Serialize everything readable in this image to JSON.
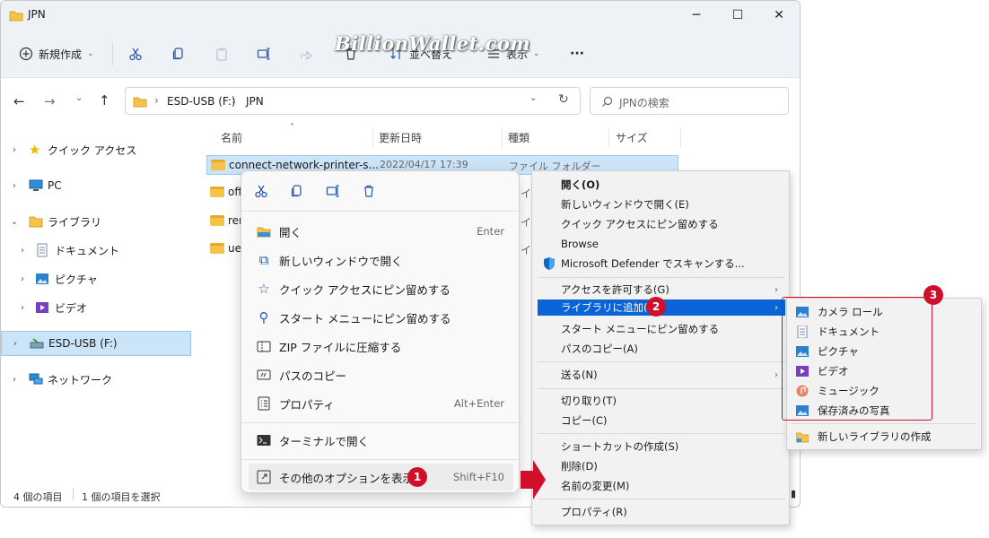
{
  "window": {
    "title": "JPN",
    "minimize_icon": "─",
    "maximize_icon": "☐",
    "close_icon": "✕"
  },
  "watermark": "BillionWallet.com",
  "toolbar": {
    "new_label": "新規作成",
    "sort_label": "並べ替え",
    "view_label": "表示",
    "more_label": "···"
  },
  "address": {
    "drive": "ESD-USB (F:)",
    "folder": "JPN",
    "sep": "›"
  },
  "search": {
    "placeholder": "JPNの検索"
  },
  "sidebar": {
    "items": [
      {
        "label": "クイック アクセス"
      },
      {
        "label": "PC"
      },
      {
        "label": "ライブラリ"
      },
      {
        "label": "ドキュメント"
      },
      {
        "label": "ピクチャ"
      },
      {
        "label": "ビデオ"
      },
      {
        "label": "ESD-USB (F:)"
      },
      {
        "label": "ネットワーク"
      }
    ]
  },
  "columns": {
    "name": "名前",
    "date": "更新日時",
    "type": "種類",
    "size": "サイズ"
  },
  "files": [
    {
      "name": "connect-network-printer-s...",
      "date": "2022/04/17 17:39",
      "type": "ファイル フォルダー"
    },
    {
      "name": "off",
      "date": "",
      "type": "イ"
    },
    {
      "name": "ren",
      "date": "",
      "type": "イ"
    },
    {
      "name": "ue",
      "date": "",
      "type": "イ"
    }
  ],
  "status": {
    "count": "4 個の項目",
    "selected": "1 個の項目を選択"
  },
  "context_menu": {
    "items": [
      {
        "label": "開く",
        "shortcut": "Enter"
      },
      {
        "label": "新しいウィンドウで開く",
        "shortcut": ""
      },
      {
        "label": "クイック アクセスにピン留めする",
        "shortcut": ""
      },
      {
        "label": "スタート メニューにピン留めする",
        "shortcut": ""
      },
      {
        "label": "ZIP ファイルに圧縮する",
        "shortcut": ""
      },
      {
        "label": "パスのコピー",
        "shortcut": ""
      },
      {
        "label": "プロパティ",
        "shortcut": "Alt+Enter"
      },
      {
        "label": "ターミナルで開く",
        "shortcut": ""
      },
      {
        "label": "その他のオプションを表示",
        "shortcut": "Shift+F10"
      }
    ]
  },
  "classic_menu": {
    "items": [
      {
        "label": "開く(O)"
      },
      {
        "label": "新しいウィンドウで開く(E)"
      },
      {
        "label": "クイック アクセスにピン留めする"
      },
      {
        "label": "Browse"
      },
      {
        "label": "Microsoft Defender でスキャンする..."
      },
      {
        "label": "アクセスを許可する(G)"
      },
      {
        "label": "ライブラリに追加(I)"
      },
      {
        "label": "スタート メニューにピン留めする"
      },
      {
        "label": "パスのコピー(A)"
      },
      {
        "label": "送る(N)"
      },
      {
        "label": "切り取り(T)"
      },
      {
        "label": "コピー(C)"
      },
      {
        "label": "ショートカットの作成(S)"
      },
      {
        "label": "削除(D)"
      },
      {
        "label": "名前の変更(M)"
      },
      {
        "label": "プロパティ(R)"
      }
    ]
  },
  "submenu": {
    "items": [
      {
        "label": "カメラ ロール"
      },
      {
        "label": "ドキュメント"
      },
      {
        "label": "ピクチャ"
      },
      {
        "label": "ビデオ"
      },
      {
        "label": "ミュージック"
      },
      {
        "label": "保存済みの写真"
      },
      {
        "label": "新しいライブラリの作成"
      }
    ]
  },
  "badges": {
    "b1": "1",
    "b2": "2",
    "b3": "3"
  },
  "colors": {
    "accent": "#0a64d6",
    "highlight": "#d0102a",
    "selection": "#cce4f7"
  }
}
